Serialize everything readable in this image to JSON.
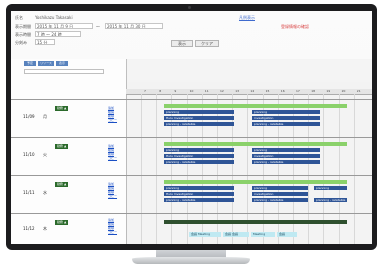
{
  "form": {
    "name_label": "氏名",
    "name_value": "Yoshikazu Takasaki",
    "date_label": "表示期間",
    "date_from": "2015 年 11 月 9 日",
    "date_to": "2015 年 11 月 30 日",
    "time_label": "表示時間",
    "time_value": "7 時 ～ 24 時",
    "unit_label": "分刻み",
    "unit_value": "15 分",
    "link_blue": "凡例表示",
    "link_red": "登録情報の確認",
    "display_button": "表示",
    "clear_button": "クリア"
  },
  "left_tabs": [
    "予定",
    "リソース",
    "表示"
  ],
  "hours": [
    "7",
    "8",
    "9",
    "10",
    "11",
    "12",
    "13",
    "14",
    "15",
    "16",
    "17",
    "18",
    "19",
    "20",
    "21"
  ],
  "rows": [
    {
      "date": "11/09",
      "weekday": "月",
      "badge": "勤務 ▲",
      "actions": [
        "追加",
        "複製",
        "削除",
        "コピー"
      ],
      "tasks": [
        {
          "label": "planning"
        },
        {
          "label": "planning"
        },
        {
          "label": "Hulu Investigation"
        },
        {
          "label": "investigation"
        },
        {
          "label": "planning - relatable"
        },
        {
          "label": "planning - relatable"
        }
      ]
    },
    {
      "date": "11/10",
      "weekday": "火",
      "badge": "勤務 ▲",
      "actions": [
        "追加",
        "複製",
        "削除",
        "コピー"
      ],
      "tasks": [
        {
          "label": "planning"
        },
        {
          "label": "planning"
        },
        {
          "label": "Hulu Investigation"
        },
        {
          "label": "investigation"
        },
        {
          "label": "planning - relatable"
        },
        {
          "label": "planning - relatable"
        }
      ]
    },
    {
      "date": "11/11",
      "weekday": "水",
      "badge": "勤務 ▲",
      "actions": [
        "追加",
        "複製",
        "削除",
        "コピー"
      ],
      "tasks": [
        {
          "label": "planning"
        },
        {
          "label": "planning"
        },
        {
          "label": "planning"
        },
        {
          "label": "Hulu Investigation"
        },
        {
          "label": "investigation"
        },
        {
          "label": "planning - relatable"
        },
        {
          "label": "planning - relatable"
        },
        {
          "label": "planning - relatable"
        }
      ]
    },
    {
      "date": "11/12",
      "weekday": "木",
      "badge": "勤務 ▲",
      "actions": [
        "追加",
        "複製",
        "削除",
        "コピー"
      ],
      "tasks": [
        {
          "label": "会議  Meeting"
        },
        {
          "label": "会議  会議"
        },
        {
          "label": "Meeting"
        },
        {
          "label": "会議"
        }
      ]
    }
  ]
}
